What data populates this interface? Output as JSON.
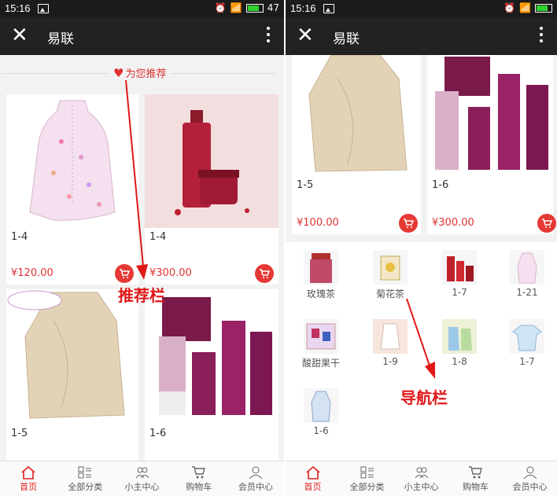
{
  "status": {
    "time": "15:16",
    "battery": "47"
  },
  "app": {
    "title": "易联"
  },
  "recommend": {
    "label": "为您推荐"
  },
  "products": [
    {
      "name": "1-4",
      "price": "¥120.00"
    },
    {
      "name": "1-4",
      "price": "¥300.00"
    },
    {
      "name": "1-5",
      "price": "¥100.00"
    },
    {
      "name": "1-6",
      "price": "¥300.00"
    }
  ],
  "nav_items": [
    {
      "label": "玫瑰茶"
    },
    {
      "label": "菊花茶"
    },
    {
      "label": "1-7"
    },
    {
      "label": "1-21"
    },
    {
      "label": "酸甜果干"
    },
    {
      "label": "1-9"
    },
    {
      "label": "1-8"
    },
    {
      "label": "1-7"
    },
    {
      "label": "1-6"
    }
  ],
  "tabs": [
    {
      "label": "首页",
      "icon": "home-icon"
    },
    {
      "label": "全部分类",
      "icon": "category-icon"
    },
    {
      "label": "小主中心",
      "icon": "group-icon"
    },
    {
      "label": "购物车",
      "icon": "cart-icon"
    },
    {
      "label": "会员中心",
      "icon": "user-icon"
    }
  ],
  "annotations": {
    "recommend_bar": "推荐栏",
    "nav_bar": "导航栏"
  },
  "colors": {
    "accent": "#e02020",
    "appbar": "#222222"
  }
}
